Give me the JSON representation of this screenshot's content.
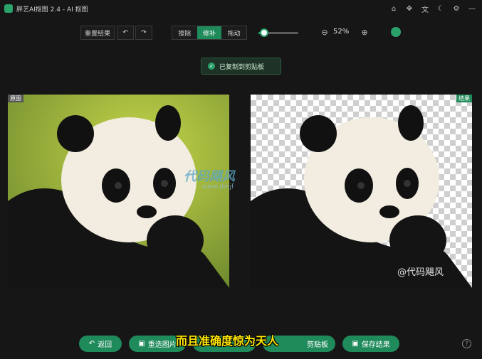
{
  "app": {
    "title": "胖艺AI抠图 2.4 - AI 抠图"
  },
  "window_icons": [
    "home-icon",
    "puzzle-icon",
    "translate-icon",
    "moon-icon",
    "settings-icon",
    "minimize-icon"
  ],
  "toolbar": {
    "reset_label": "重置结果",
    "undo_icon": "undo-icon",
    "redo_icon": "redo-icon",
    "modes": [
      "擦除",
      "修补",
      "拖动"
    ],
    "active_mode": "修补",
    "brush_level": 0.15,
    "zoom": "52%"
  },
  "toast": {
    "text": "已复制到剪贴板"
  },
  "panels": {
    "original_tag": "原图",
    "result_tag": "结果",
    "result_watermark": "@代码飓风"
  },
  "overlay_watermark": {
    "text": "代码飓风",
    "url": "www.dmjf"
  },
  "bottom": {
    "back_label": "返回",
    "reselect_label": "重选图片",
    "copy_label": "剪贴板",
    "save_label": "保存结果"
  },
  "subtitle": "而且准确度惊为天人",
  "colors": {
    "accent": "#1f8a5a",
    "subtitle": "#ffe600"
  }
}
